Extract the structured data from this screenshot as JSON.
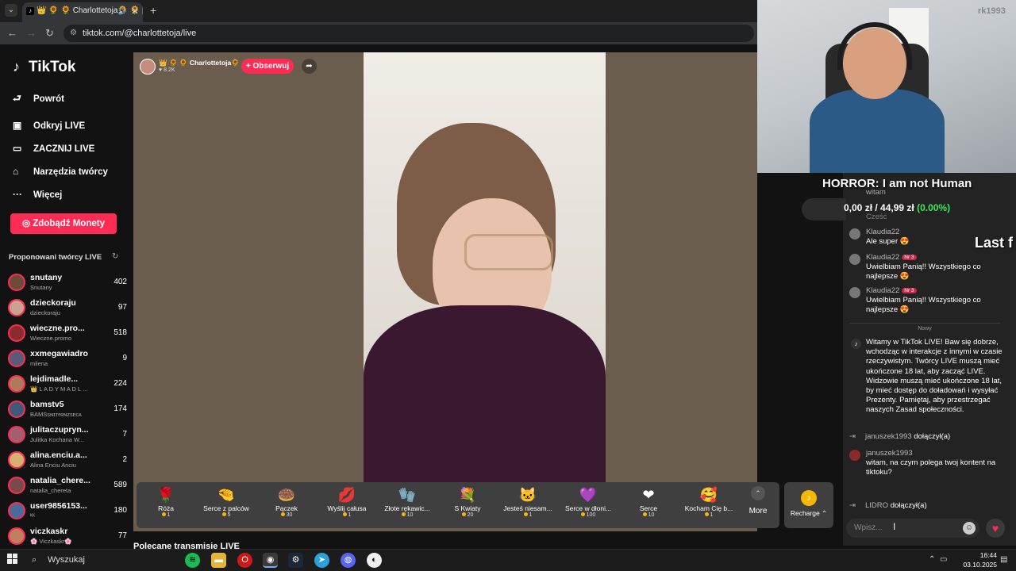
{
  "browser": {
    "tab_title": "👑 🌻 🌻 Charlottetoja🌻 🌻 | T",
    "url": "tiktok.com/@charlottetoja/live",
    "new_tab": "+",
    "close": "✕"
  },
  "sidebar": {
    "brand": "TikTok",
    "back": "Powrót",
    "nav": [
      {
        "label": "Odkryj LIVE",
        "icon": "tv-icon"
      },
      {
        "label": "ZACZNIJ LIVE",
        "icon": "camera-icon"
      },
      {
        "label": "Narzędzia twórcy",
        "icon": "home-icon"
      },
      {
        "label": "Więcej",
        "icon": "more-icon"
      }
    ],
    "coins_button": "Zdobądź Monety",
    "suggested_header": "Proponowani twórcy LIVE",
    "creators": [
      {
        "name": "snutany",
        "sub": "Snutany",
        "count": "402",
        "color": "#6b4c3b"
      },
      {
        "name": "dzieckoraju",
        "sub": "dzieckoraju",
        "count": "97",
        "color": "#c9a38f"
      },
      {
        "name": "wieczne.pro...",
        "sub": "Wieczne.promo",
        "count": "518",
        "color": "#8a2c2c"
      },
      {
        "name": "xxmegawiadro",
        "sub": "milena",
        "count": "9",
        "color": "#5a5a7a"
      },
      {
        "name": "lejdimadle...",
        "sub": "👑 L A D Y M A D L ...",
        "count": "224",
        "color": "#b07a5a"
      },
      {
        "name": "bamstv5",
        "sub": "BAMSsɴɪᴛғʀɴᴢsᴇᴄᴀ",
        "count": "174",
        "color": "#3f5a7a"
      },
      {
        "name": "julitaczupryn...",
        "sub": "Julitka Kochana W...",
        "count": "7",
        "color": "#a06070"
      },
      {
        "name": "alina.enciu.a...",
        "sub": "Alina Enciu Anciu",
        "count": "2",
        "color": "#d8b070"
      },
      {
        "name": "natalia_chere...",
        "sub": "natalia_chereta",
        "count": "589",
        "color": "#7a4a4a"
      },
      {
        "name": "user9856153...",
        "sub": "ᴷᴷ",
        "count": "180",
        "color": "#4a6a9a"
      },
      {
        "name": "viczkaskr",
        "sub": "🌸 Viczkaskr🌸",
        "count": "77",
        "color": "#c08060"
      }
    ]
  },
  "host": {
    "name": "👑 🌻 🌻 Charlottetoja🌻 ...",
    "likes": "♥ 8.2K",
    "follow": "+ Obserwuj"
  },
  "gifts": [
    {
      "name": "Róża",
      "price": "1",
      "icon": "🌹"
    },
    {
      "name": "Serce z palców",
      "price": "5",
      "icon": "🤏"
    },
    {
      "name": "Pączek",
      "price": "30",
      "icon": "🍩"
    },
    {
      "name": "Wyślij całusa",
      "price": "1",
      "icon": "💋"
    },
    {
      "name": "Złote rękawic...",
      "price": "10",
      "icon": "🧤"
    },
    {
      "name": "S Kwiaty",
      "price": "20",
      "icon": "💐"
    },
    {
      "name": "Jesteś niesam...",
      "price": "1",
      "icon": "🐱"
    },
    {
      "name": "Serce w dłoni...",
      "price": "100",
      "icon": "💜"
    },
    {
      "name": "Serce",
      "price": "10",
      "icon": "❤"
    },
    {
      "name": "Kocham Cię b...",
      "price": "1",
      "icon": "🥰"
    }
  ],
  "more": "More",
  "recharge": "Recharge ⌃",
  "recommended": "Polecane transmisje LIVE",
  "overlay": {
    "title": "HORROR: I am not Human",
    "money": "0,00 zł / 44,99 zł",
    "pct": "(0.00%)",
    "last": "Last f",
    "cam_label": "rk1993"
  },
  "chat": {
    "faded": [
      "witam",
      "Cześć"
    ],
    "messages": [
      {
        "user": "Klaudia22",
        "badge": "",
        "text": "Ale super 😍"
      },
      {
        "user": "Klaudia22",
        "badge": "Nr 3",
        "text": "Uwielbiam Panią!! Wszystkiego co najlepsze 😍"
      },
      {
        "user": "Klaudia22",
        "badge": "Nr 3",
        "text": "Uwielbiam Panią!! Wszystkiego co najlepsze 😍"
      }
    ],
    "new_divider": "Nowy",
    "system": "Witamy w TikTok LIVE! Baw się dobrze, wchodząc w interakcje z innymi w czasie rzeczywistym. Twórcy LIVE muszą mieć ukończone 18 lat, aby zacząć LIVE. Widzowie muszą mieć ukończone 18 lat, by mieć dostęp do doładowań i wysyłać Prezenty. Pamiętaj, aby przestrzegać naszych Zasad społeczności.",
    "join1_user": "januszek1993",
    "join_text": "dołączył(a)",
    "msg2_user": "januszek1993",
    "msg2_text": "witam, na czym polega twoj kontent na tiktoku?",
    "join2_user": "LIDRO",
    "input_placeholder": "Wpisz..."
  },
  "taskbar": {
    "search": "Wyszukaj",
    "time": "16:44",
    "date": "03.10.2025"
  }
}
